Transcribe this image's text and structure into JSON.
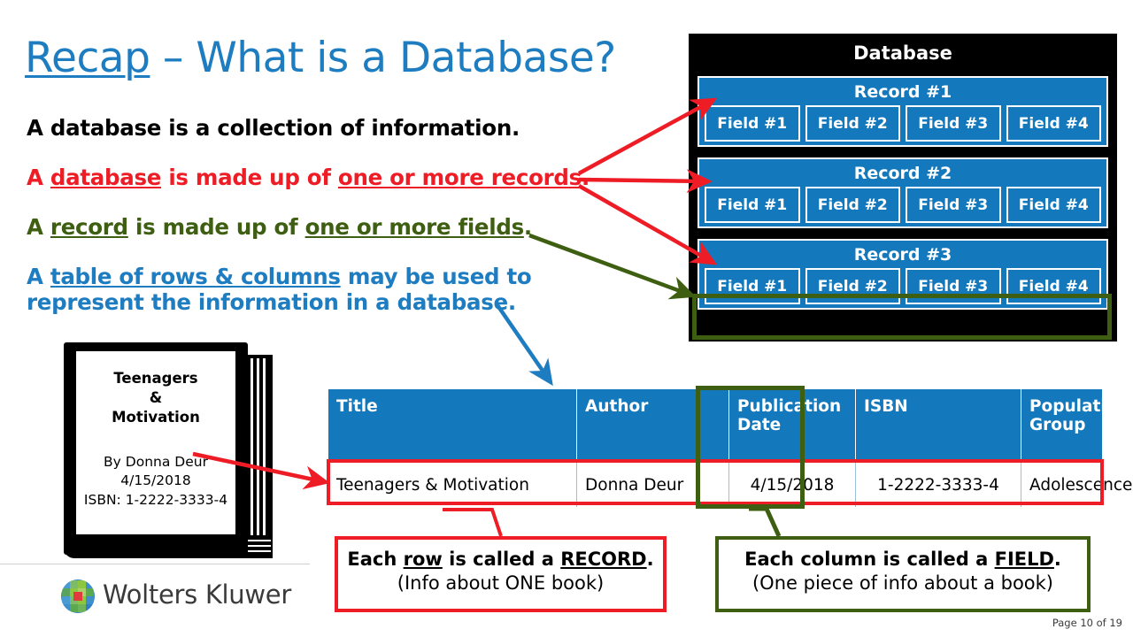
{
  "slide": {
    "title_parts": {
      "underlined": "Recap",
      "rest": " – What is a Database?"
    },
    "page_label": "Page 10 of 19"
  },
  "bullets": [
    {
      "id": "b1",
      "color": "#000000",
      "text": "A database is a collection of information."
    },
    {
      "id": "b2",
      "color": "#ee1c25",
      "text": "A database is made up of one or more records.",
      "pre": "A ",
      "u1": "database",
      "mid": " is made up of ",
      "u2": "one or more records",
      "post": "."
    },
    {
      "id": "b3",
      "color": "#3e5f11",
      "text": "A record is made up of one or more fields.",
      "pre": "A ",
      "u1": "record",
      "mid": " is made up of ",
      "u2": "one or more fields",
      "post": "."
    },
    {
      "id": "b4",
      "color": "#1e7cc0",
      "text": "A table of rows & columns may be used to represent the information in a database.",
      "pre": "A ",
      "u1": "table of rows & columns",
      "mid": " may be used to",
      "line2": "represent the information in a database."
    }
  ],
  "database_panel": {
    "title": "Database",
    "records": [
      {
        "label": "Record #1",
        "fields": [
          "Field #1",
          "Field #2",
          "Field #3",
          "Field #4"
        ]
      },
      {
        "label": "Record #2",
        "fields": [
          "Field #1",
          "Field #2",
          "Field #3",
          "Field #4"
        ]
      },
      {
        "label": "Record #3",
        "fields": [
          "Field #1",
          "Field #2",
          "Field #3",
          "Field #4"
        ]
      }
    ],
    "panel_bg": "#000000",
    "record_bg": "#1479bc",
    "highlight_color": "#3e5f11"
  },
  "book": {
    "title_line1": "Teenagers",
    "title_line2": "&",
    "title_line3": "Motivation",
    "author": "By Donna Deur",
    "date": "4/15/2018",
    "isbn": "ISBN: 1-2222-3333-4"
  },
  "table": {
    "headers": [
      "Title",
      "Author",
      "Publication Date",
      "ISBN",
      "Population Group"
    ],
    "rows": [
      [
        "Teenagers & Motivation",
        "Donna Deur",
        "4/15/2018",
        "1-2222-3333-4",
        "Adolescence"
      ]
    ],
    "header_bg": "#1479bc",
    "row_outline_color": "#ee1c25",
    "column_outline_color": "#3e5f11"
  },
  "callouts": [
    {
      "id": "record",
      "line1_pre": "Each ",
      "line1_u1": "row",
      "line1_mid": " is called a ",
      "line1_u2": "RECORD",
      "line1_post": ".",
      "line2": "(Info about ONE book)",
      "border_color": "#ee1c25"
    },
    {
      "id": "field",
      "line1_pre": "Each column is called a ",
      "line1_u1": "FIELD",
      "line1_post": ".",
      "line2": "(One piece of info about a book)",
      "border_color": "#3e5f11"
    }
  ],
  "footer": {
    "logo_text": "Wolters Kluwer",
    "logo_accent": "#e03a3e"
  }
}
